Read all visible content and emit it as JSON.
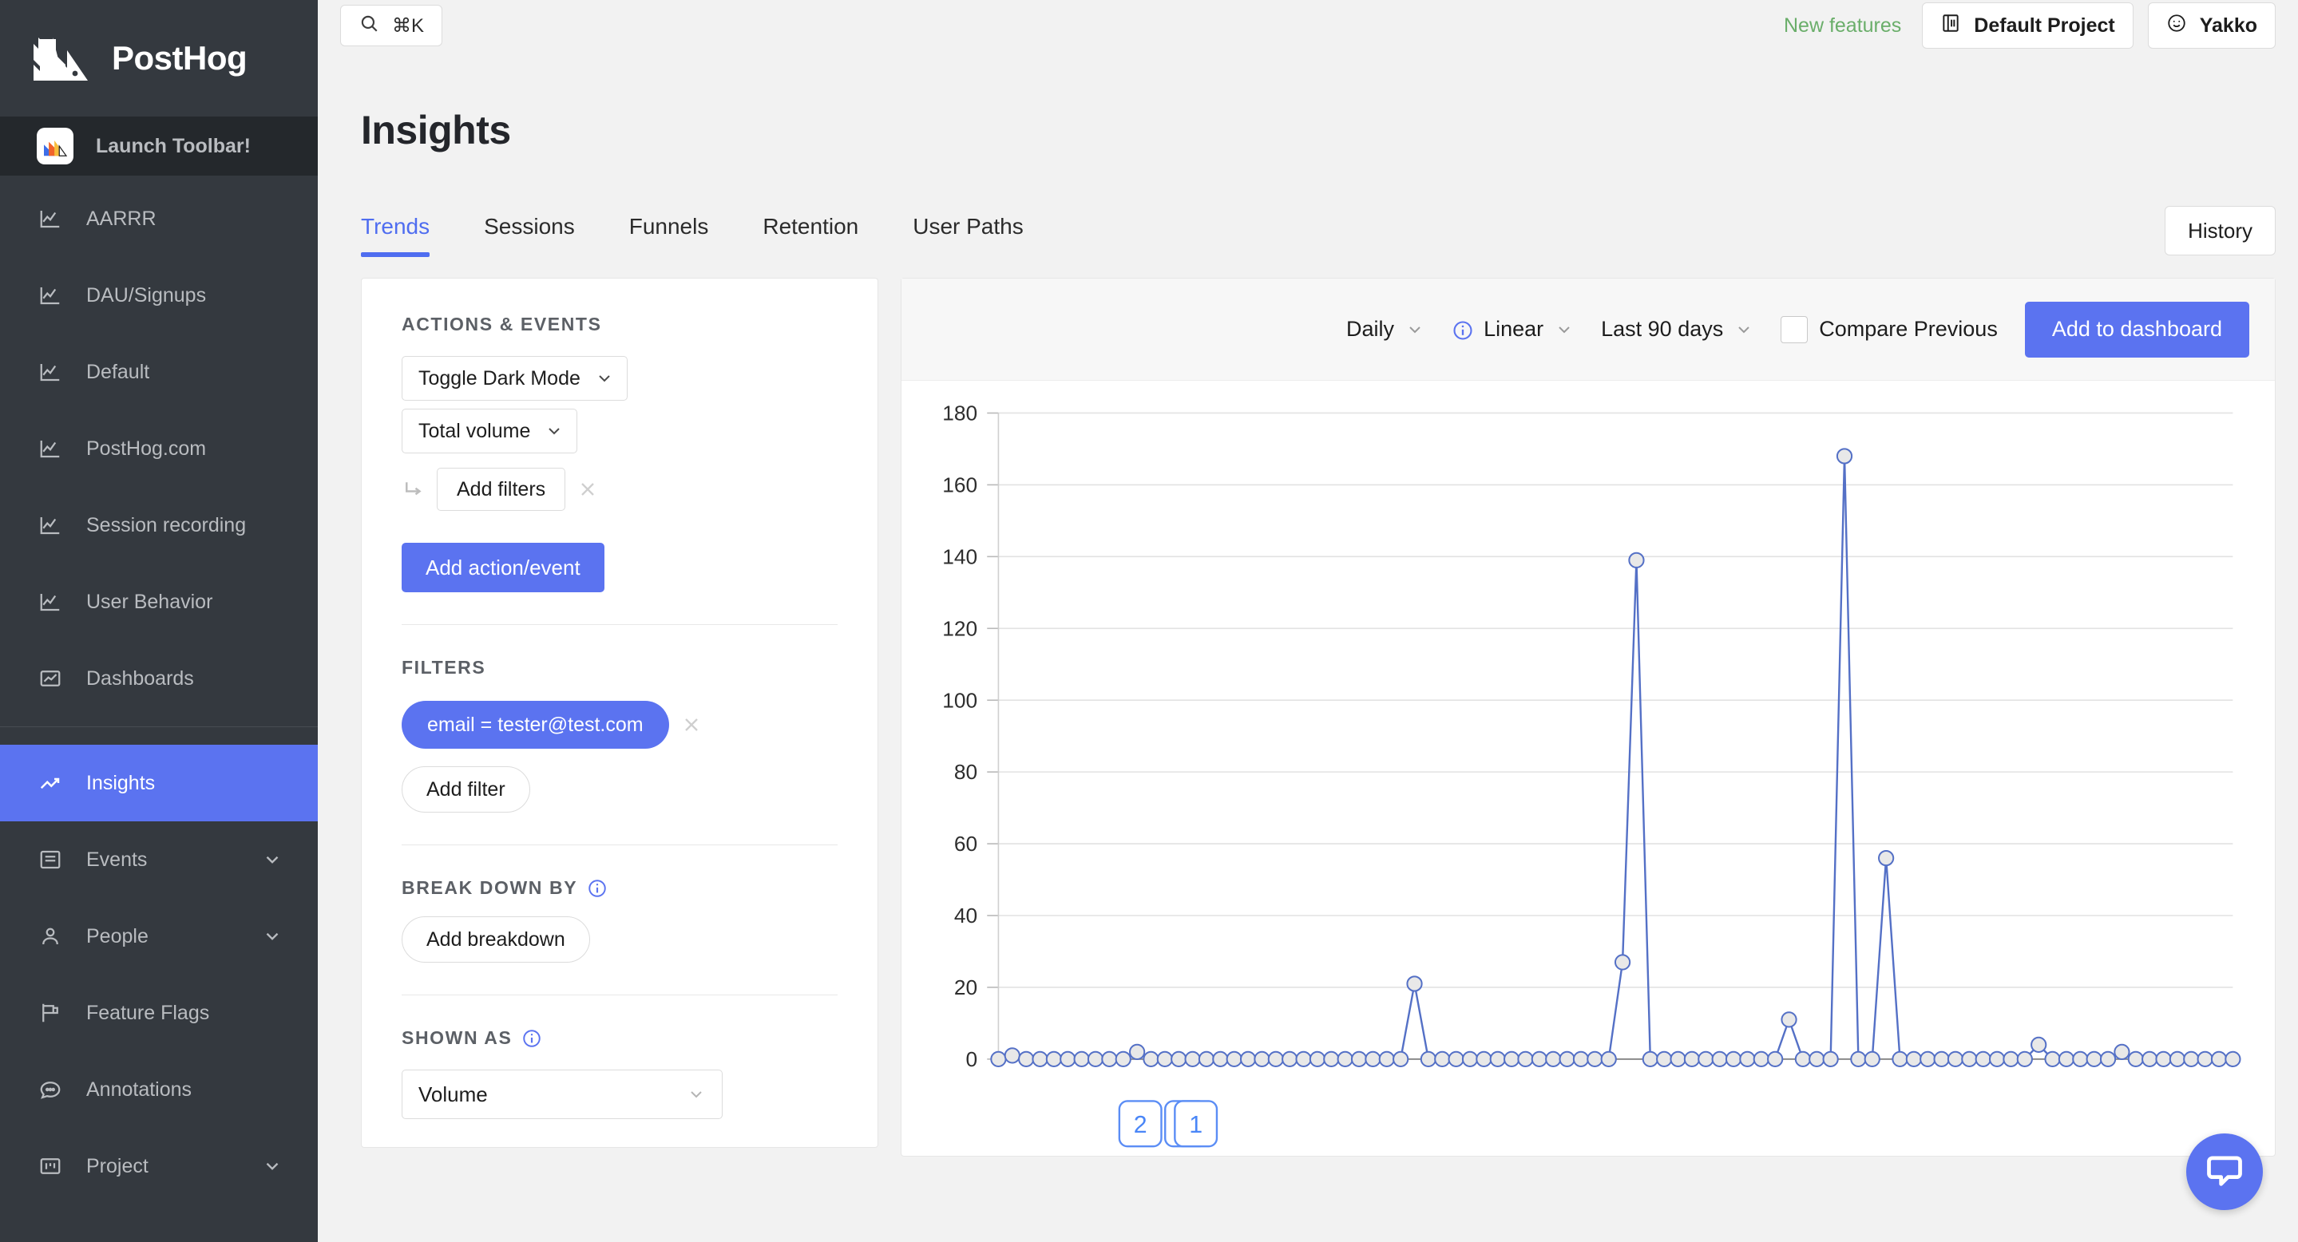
{
  "sidebar": {
    "brand_name": "PostHog",
    "toolbar_label": "Launch Toolbar!",
    "items": [
      {
        "label": "AARRR",
        "icon": "line-chart-icon",
        "active": false,
        "chevron": false
      },
      {
        "label": "DAU/Signups",
        "icon": "line-chart-icon",
        "active": false,
        "chevron": false
      },
      {
        "label": "Default",
        "icon": "line-chart-icon",
        "active": false,
        "chevron": false
      },
      {
        "label": "PostHog.com",
        "icon": "line-chart-icon",
        "active": false,
        "chevron": false
      },
      {
        "label": "Session recording",
        "icon": "line-chart-icon",
        "active": false,
        "chevron": false
      },
      {
        "label": "User Behavior",
        "icon": "line-chart-icon",
        "active": false,
        "chevron": false
      },
      {
        "label": "Dashboards",
        "icon": "dashboard-icon",
        "active": false,
        "chevron": false
      },
      {
        "label": "Insights",
        "icon": "trending-up-icon",
        "active": true,
        "chevron": false
      },
      {
        "label": "Events",
        "icon": "list-icon",
        "active": false,
        "chevron": true
      },
      {
        "label": "People",
        "icon": "person-icon",
        "active": false,
        "chevron": true
      },
      {
        "label": "Feature Flags",
        "icon": "flag-icon",
        "active": false,
        "chevron": false
      },
      {
        "label": "Annotations",
        "icon": "comment-icon",
        "active": false,
        "chevron": false
      },
      {
        "label": "Project",
        "icon": "project-icon",
        "active": false,
        "chevron": true
      }
    ]
  },
  "topbar": {
    "search_shortcut": "⌘K",
    "new_features": "New features",
    "project": "Default Project",
    "user": "Yakko"
  },
  "header": {
    "title": "Insights",
    "history_label": "History"
  },
  "tabs": [
    {
      "label": "Trends",
      "active": true
    },
    {
      "label": "Sessions",
      "active": false
    },
    {
      "label": "Funnels",
      "active": false
    },
    {
      "label": "Retention",
      "active": false
    },
    {
      "label": "User Paths",
      "active": false
    }
  ],
  "filters_panel": {
    "actions_events_label": "ACTIONS & EVENTS",
    "event_name": "Toggle Dark Mode",
    "math_type": "Total volume",
    "add_filters_label": "Add filters",
    "add_action_event_label": "Add action/event",
    "filters_label": "FILTERS",
    "active_filter": "email = tester@test.com",
    "add_filter_label": "Add filter",
    "breakdown_label": "BREAK DOWN BY",
    "add_breakdown_label": "Add breakdown",
    "shown_as_label": "SHOWN AS",
    "shown_as_value": "Volume"
  },
  "chart_controls": {
    "interval": "Daily",
    "scale": "Linear",
    "date_range": "Last 90 days",
    "compare_label": "Compare Previous",
    "compare_checked": false,
    "add_to_dashboard_label": "Add to dashboard"
  },
  "annotations": [
    {
      "label": "2",
      "stacked": false
    },
    {
      "label": "1",
      "stacked": true
    }
  ],
  "colors": {
    "accent_blue": "#5b73f0",
    "sidebar_bg": "#34393f",
    "green": "#6aae6a",
    "line": "#5470c6"
  },
  "chart_data": {
    "type": "line",
    "title": "",
    "xlabel": "",
    "ylabel": "",
    "ylim": [
      0,
      180
    ],
    "yticks": [
      0,
      20,
      40,
      60,
      80,
      100,
      120,
      140,
      160,
      180
    ],
    "grid": true,
    "legend": "none",
    "series": [
      {
        "name": "Toggle Dark Mode",
        "values": [
          0,
          1,
          0,
          0,
          0,
          0,
          0,
          0,
          0,
          0,
          2,
          0,
          0,
          0,
          0,
          0,
          0,
          0,
          0,
          0,
          0,
          0,
          0,
          0,
          0,
          0,
          0,
          0,
          0,
          0,
          21,
          0,
          0,
          0,
          0,
          0,
          0,
          0,
          0,
          0,
          0,
          0,
          0,
          0,
          0,
          27,
          139,
          0,
          0,
          0,
          0,
          0,
          0,
          0,
          0,
          0,
          0,
          11,
          0,
          0,
          0,
          168,
          0,
          0,
          56,
          0,
          0,
          0,
          0,
          0,
          0,
          0,
          0,
          0,
          0,
          4,
          0,
          0,
          0,
          0,
          0,
          2,
          0,
          0,
          0,
          0,
          0,
          0,
          0,
          0
        ]
      }
    ]
  }
}
